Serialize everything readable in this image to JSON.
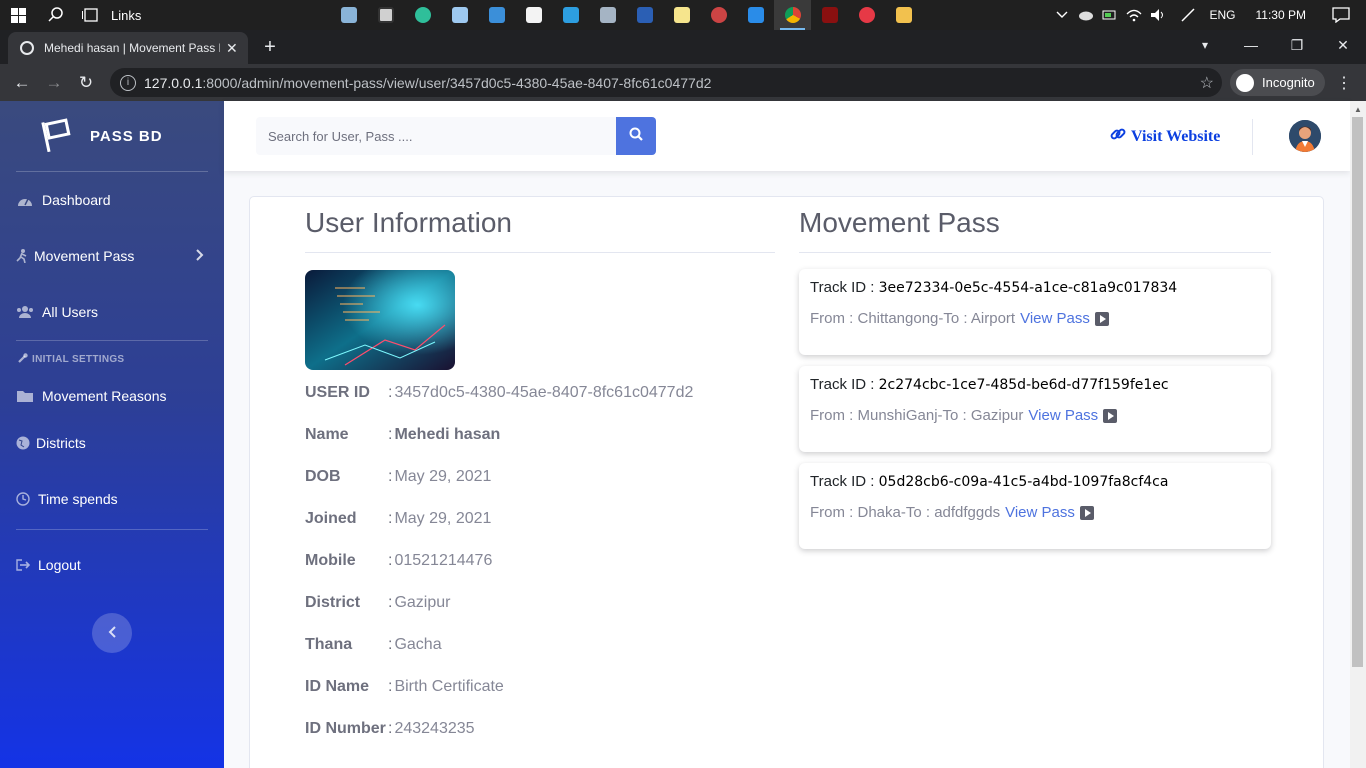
{
  "taskbar": {
    "links_label": "Links",
    "lang": "ENG",
    "time": "11:30 PM"
  },
  "browser": {
    "tab_title": "Mehedi hasan | Movement Pass B",
    "url_host": "127.0.0.1",
    "url_path": ":8000/admin/movement-pass/view/user/3457d0c5-4380-45ae-8407-8fc61c0477d2",
    "incognito_label": "Incognito"
  },
  "sidebar": {
    "brand": "PASS BD",
    "items": [
      {
        "label": "Dashboard",
        "icon": "tachometer-icon"
      },
      {
        "label": "Movement Pass",
        "icon": "running-icon"
      },
      {
        "label": "All Users",
        "icon": "users-icon"
      }
    ],
    "heading": "INITIAL SETTINGS",
    "settings": [
      {
        "label": "Movement Reasons",
        "icon": "folder-icon"
      },
      {
        "label": "Districts",
        "icon": "globe-icon"
      },
      {
        "label": "Time spends",
        "icon": "clock-icon"
      }
    ],
    "logout": "Logout"
  },
  "topbar": {
    "search_placeholder": "Search for User, Pass ....",
    "visit_website": "Visit Website"
  },
  "user_info": {
    "title": "User Information",
    "rows": [
      {
        "label": "USER ID",
        "value": "3457d0c5-4380-45ae-8407-8fc61c0477d2"
      },
      {
        "label": "Name",
        "value": "Mehedi hasan"
      },
      {
        "label": "DOB",
        "value": "May 29, 2021"
      },
      {
        "label": "Joined",
        "value": "May 29, 2021"
      },
      {
        "label": "Mobile",
        "value": "01521214476"
      },
      {
        "label": "District",
        "value": "Gazipur"
      },
      {
        "label": "Thana",
        "value": "Gacha"
      },
      {
        "label": "ID Name",
        "value": "Birth Certificate"
      },
      {
        "label": "ID Number",
        "value": "243243235"
      }
    ],
    "separator": ":"
  },
  "movement_pass": {
    "title": "Movement Pass",
    "track_label": "Track ID : ",
    "view_label": "View Pass",
    "passes": [
      {
        "track_id": "3ee72334-0e5c-4554-a1ce-c81a9c017834",
        "route": "From : Chittangong-To : Airport"
      },
      {
        "track_id": "2c274cbc-1ce7-485d-be6d-d77f159fe1ec",
        "route": "From : MunshiGanj-To : Gazipur"
      },
      {
        "track_id": "05d28cb6-c09a-41c5-a4bd-1097fa8cf4ca",
        "route": "From : Dhaka-To : adfdfggds"
      }
    ]
  },
  "colors": {
    "primary": "#4e73df",
    "visit_link": "#0b3fe0",
    "sidebar_top": "#3a4a7e",
    "sidebar_bottom": "#1433e6"
  }
}
